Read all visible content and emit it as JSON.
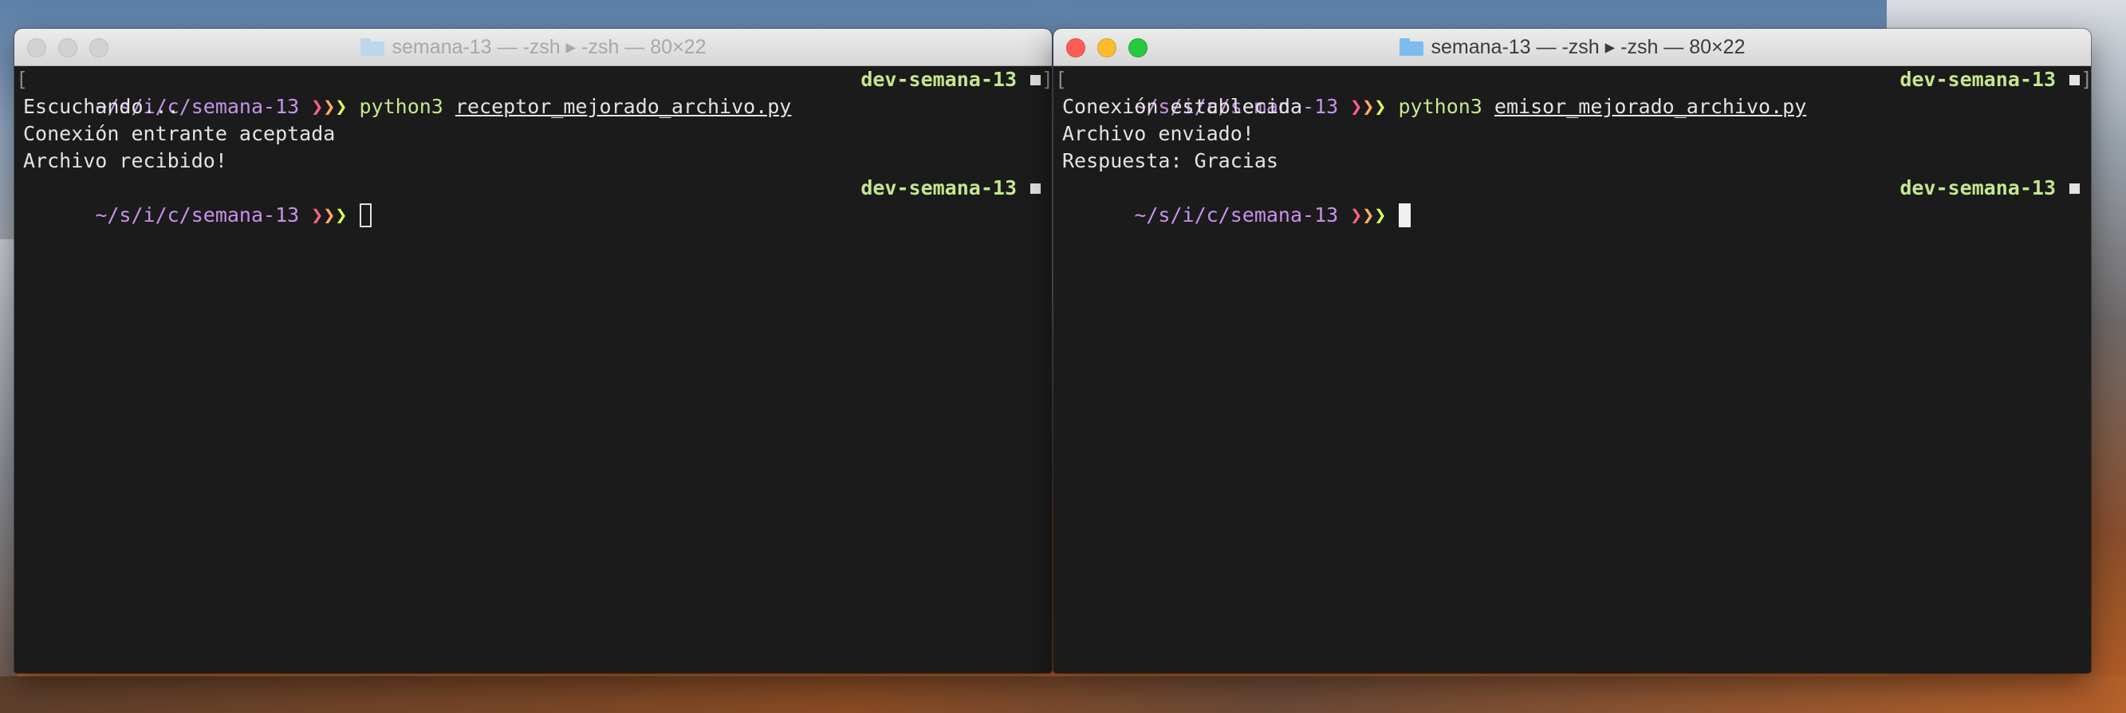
{
  "windows": [
    {
      "title": "semana-13 — -zsh ▸ -zsh — 80×22",
      "active": false,
      "lines": [
        {
          "type": "prompt",
          "path": "~/s/i/c/semana-13",
          "arrows": "❯❯❯",
          "cmd": "python3",
          "file": "receptor_mejorado_archivo.py",
          "branch": "dev-semana-13"
        },
        {
          "type": "output",
          "text": "Escuchando..."
        },
        {
          "type": "output",
          "text": "Conexión entrante aceptada"
        },
        {
          "type": "output",
          "text": "Archivo recibido!"
        },
        {
          "type": "prompt-cursor",
          "path": "~/s/i/c/semana-13",
          "arrows": "❯❯❯",
          "branch": "dev-semana-13"
        }
      ]
    },
    {
      "title": "semana-13 — -zsh ▸ -zsh — 80×22",
      "active": true,
      "lines": [
        {
          "type": "prompt",
          "path": "~/s/i/c/semana-13",
          "arrows": "❯❯❯",
          "cmd": "python3",
          "file": "emisor_mejorado_archivo.py",
          "branch": "dev-semana-13"
        },
        {
          "type": "output",
          "text": "Conexión establecida"
        },
        {
          "type": "output",
          "text": "Archivo enviado!"
        },
        {
          "type": "output",
          "text": "Respuesta: Gracias"
        },
        {
          "type": "prompt-cursor",
          "path": "~/s/i/c/semana-13",
          "arrows": "❯❯❯",
          "branch": "dev-semana-13"
        }
      ]
    }
  ],
  "icons": {
    "folder": "folder-icon",
    "close": "close-button-icon",
    "minimize": "minimize-button-icon",
    "zoom": "zoom-button-icon"
  },
  "colors": {
    "path": "#c792ea",
    "branch": "#c3e88d",
    "arrow1": "#ff5f87",
    "arrow2": "#ffaf5f",
    "arrow3": "#d7ff5f",
    "terminal_bg": "#1b1b1b"
  }
}
